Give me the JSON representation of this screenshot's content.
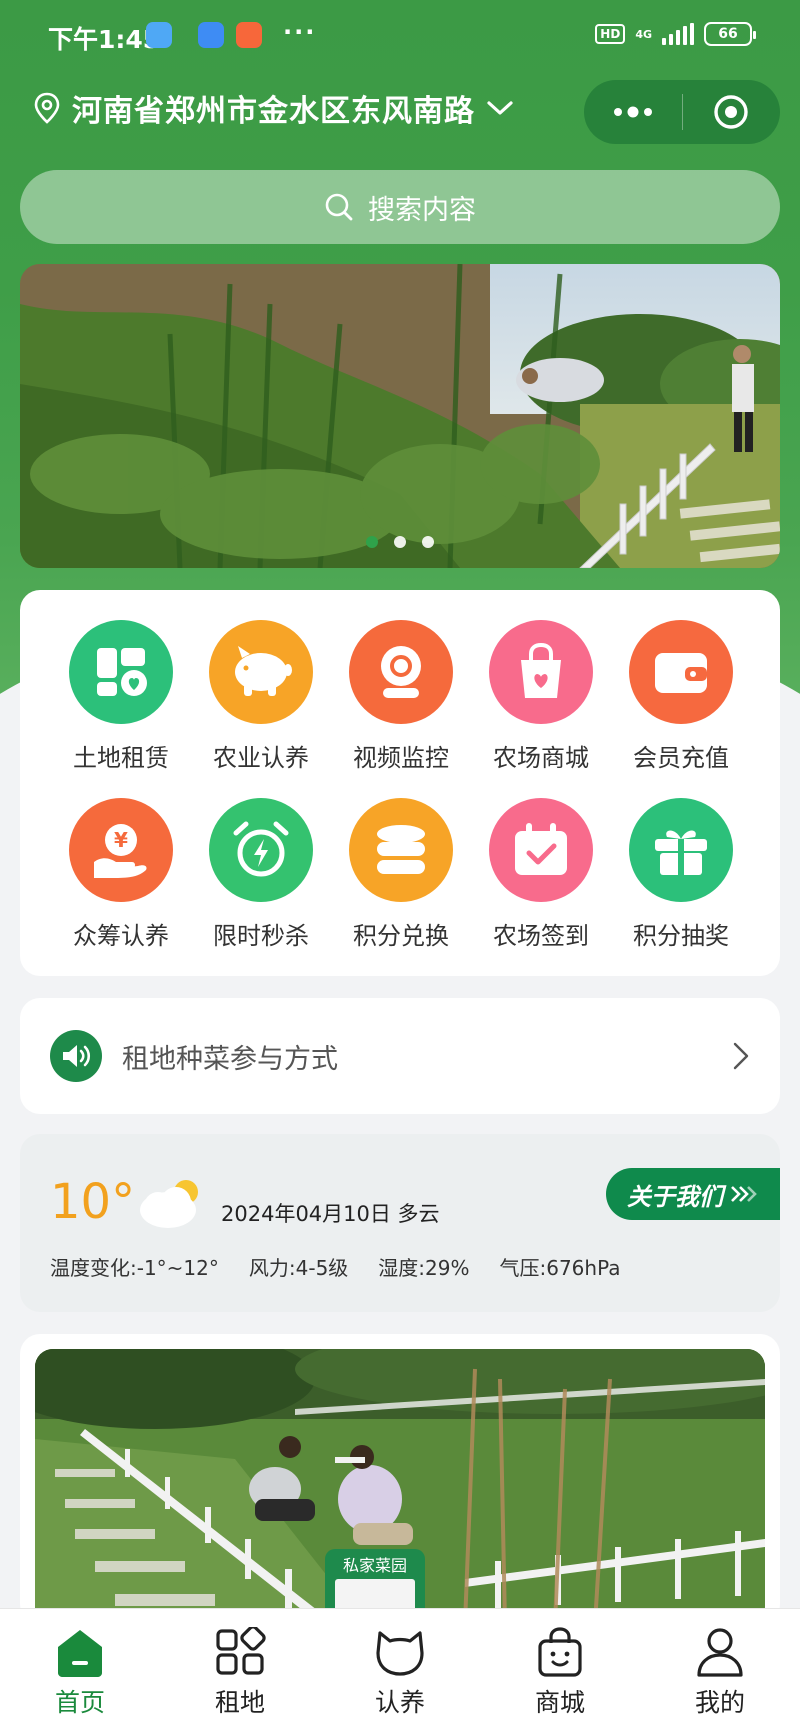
{
  "status_bar": {
    "time": "下午1:45",
    "hd": "HD",
    "network": "4G",
    "battery": "66",
    "more": "···"
  },
  "location": {
    "text": "河南省郑州市金水区东风南路"
  },
  "search": {
    "placeholder": "搜索内容"
  },
  "banner": {
    "slide_count": 3,
    "active_index": 0
  },
  "grid": {
    "items": [
      {
        "label": "土地租赁",
        "icon": "land-map-icon",
        "color": "#2cc07a"
      },
      {
        "label": "农业认养",
        "icon": "piggy-icon",
        "color": "#f7a427"
      },
      {
        "label": "视频监控",
        "icon": "camera-icon",
        "color": "#f56a3c"
      },
      {
        "label": "农场商城",
        "icon": "shopping-bag-icon",
        "color": "#f86b8c"
      },
      {
        "label": "会员充值",
        "icon": "wallet-icon",
        "color": "#f6693f"
      },
      {
        "label": "众筹认养",
        "icon": "yen-hand-icon",
        "color": "#f56a3c"
      },
      {
        "label": "限时秒杀",
        "icon": "alarm-clock-icon",
        "color": "#34c26f"
      },
      {
        "label": "积分兑换",
        "icon": "coins-icon",
        "color": "#f7a427"
      },
      {
        "label": "农场签到",
        "icon": "calendar-check-icon",
        "color": "#f86b8c"
      },
      {
        "label": "积分抽奖",
        "icon": "gift-icon",
        "color": "#2cc07a"
      }
    ]
  },
  "notice": {
    "text": "租地种菜参与方式"
  },
  "weather": {
    "temperature": "10°",
    "date_weather": "2024年04月10日 多云",
    "about_label": "关于我们",
    "temp_range": "温度变化:-1°~12°",
    "wind": "风力:4-5级",
    "humidity": "湿度:29%",
    "pressure": "气压:676hPa"
  },
  "tabbar": {
    "tabs": [
      {
        "label": "首页",
        "icon": "home-icon",
        "active": true
      },
      {
        "label": "租地",
        "icon": "grid-icon",
        "active": false
      },
      {
        "label": "认养",
        "icon": "cat-icon",
        "active": false
      },
      {
        "label": "商城",
        "icon": "shop-bag-icon",
        "active": false
      },
      {
        "label": "我的",
        "icon": "user-icon",
        "active": false
      }
    ]
  },
  "colors": {
    "brand_green": "#3c9a45",
    "accent_orange": "#f2a11e",
    "about_green": "#0f8a4c",
    "active_tab": "#1a8a3c"
  }
}
